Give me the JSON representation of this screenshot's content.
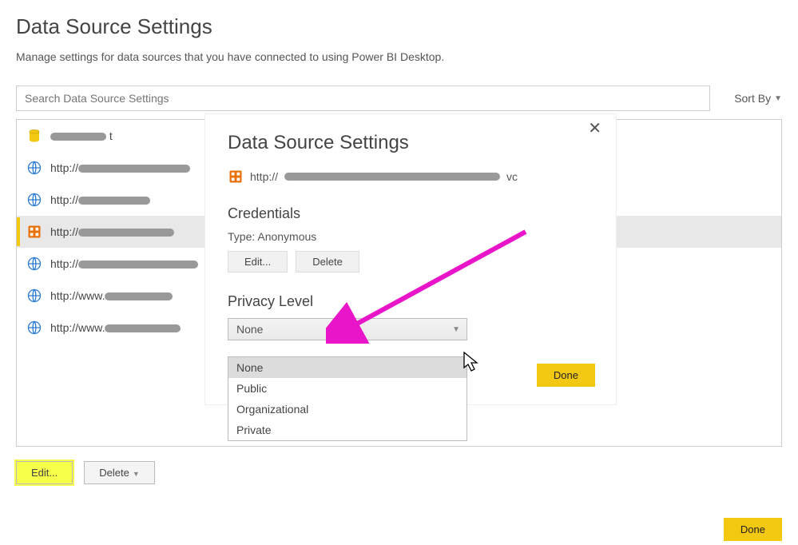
{
  "header": {
    "title": "Data Source Settings",
    "description": "Manage settings for data sources that you have connected to using Power BI Desktop."
  },
  "toolbar": {
    "search_placeholder": "Search Data Source Settings",
    "sort_label": "Sort By"
  },
  "data_sources": [
    {
      "icon": "db",
      "label": "t"
    },
    {
      "icon": "web",
      "label": "http://"
    },
    {
      "icon": "web",
      "label": "http://"
    },
    {
      "icon": "odata",
      "label": "http://",
      "selected": true
    },
    {
      "icon": "web",
      "label": "http://"
    },
    {
      "icon": "web",
      "label": "http://www."
    },
    {
      "icon": "web",
      "label": "http://www."
    }
  ],
  "bottom": {
    "edit_label": "Edit...",
    "delete_label": "Delete",
    "done_label": "Done"
  },
  "dialog": {
    "title": "Data Source Settings",
    "source_prefix": "http://",
    "source_suffix": "vc",
    "credentials_heading": "Credentials",
    "cred_type_label": "Type: Anonymous",
    "cred_edit": "Edit...",
    "cred_delete": "Delete",
    "privacy_heading": "Privacy Level",
    "privacy_selected": "None",
    "privacy_options": [
      "None",
      "Public",
      "Organizational",
      "Private"
    ],
    "done": "Done"
  }
}
